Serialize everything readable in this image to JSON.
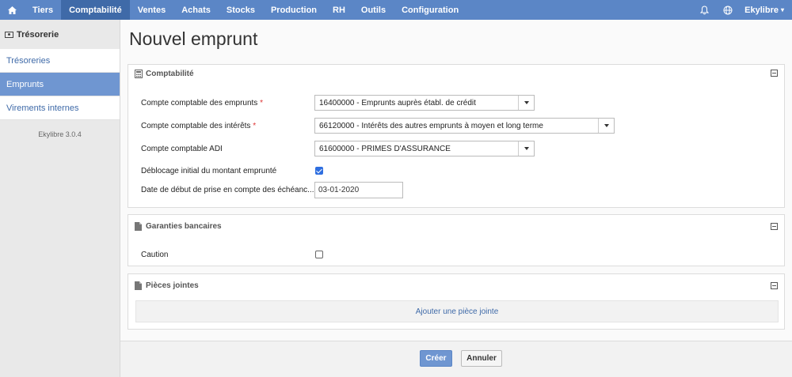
{
  "topnav": {
    "items": [
      {
        "label": "Tiers"
      },
      {
        "label": "Comptabilité"
      },
      {
        "label": "Ventes"
      },
      {
        "label": "Achats"
      },
      {
        "label": "Stocks"
      },
      {
        "label": "Production"
      },
      {
        "label": "RH"
      },
      {
        "label": "Outils"
      },
      {
        "label": "Configuration"
      }
    ],
    "active": "Comptabilité",
    "user": "Ekylibre"
  },
  "sidebar": {
    "title": "Trésorerie",
    "items": [
      {
        "label": "Trésoreries"
      },
      {
        "label": "Emprunts"
      },
      {
        "label": "Virements internes"
      }
    ],
    "version": "Ekylibre 3.0.4"
  },
  "page": {
    "title": "Nouvel emprunt"
  },
  "accounting": {
    "title": "Comptabilité",
    "loan_account_label": "Compte comptable des emprunts",
    "loan_account_value": "16400000 - Emprunts auprès établ. de crédit",
    "interest_account_label": "Compte comptable des intérêts",
    "interest_account_value": "66120000 - Intérêts des autres emprunts à moyen et long terme",
    "adi_account_label": "Compte comptable ADI",
    "adi_account_value": "61600000 - PRIMES D'ASSURANCE",
    "initial_release_label": "Déblocage initial du montant emprunté",
    "initial_release_checked": true,
    "start_date_label": "Date de début de prise en compte des échéanc...",
    "start_date_value": "03-01-2020",
    "required_mark": "*"
  },
  "guarantees": {
    "title": "Garanties bancaires",
    "caution_label": "Caution",
    "caution_checked": false
  },
  "attachments": {
    "title": "Pièces jointes",
    "add_label": "Ajouter une pièce jointe"
  },
  "actions": {
    "create_label": "Créer",
    "cancel_label": "Annuler"
  },
  "colors": {
    "topbar": "#5b86c6",
    "topbar_active": "#3f6aa8",
    "accent": "#6f96d1",
    "link": "#3f6aa8"
  }
}
